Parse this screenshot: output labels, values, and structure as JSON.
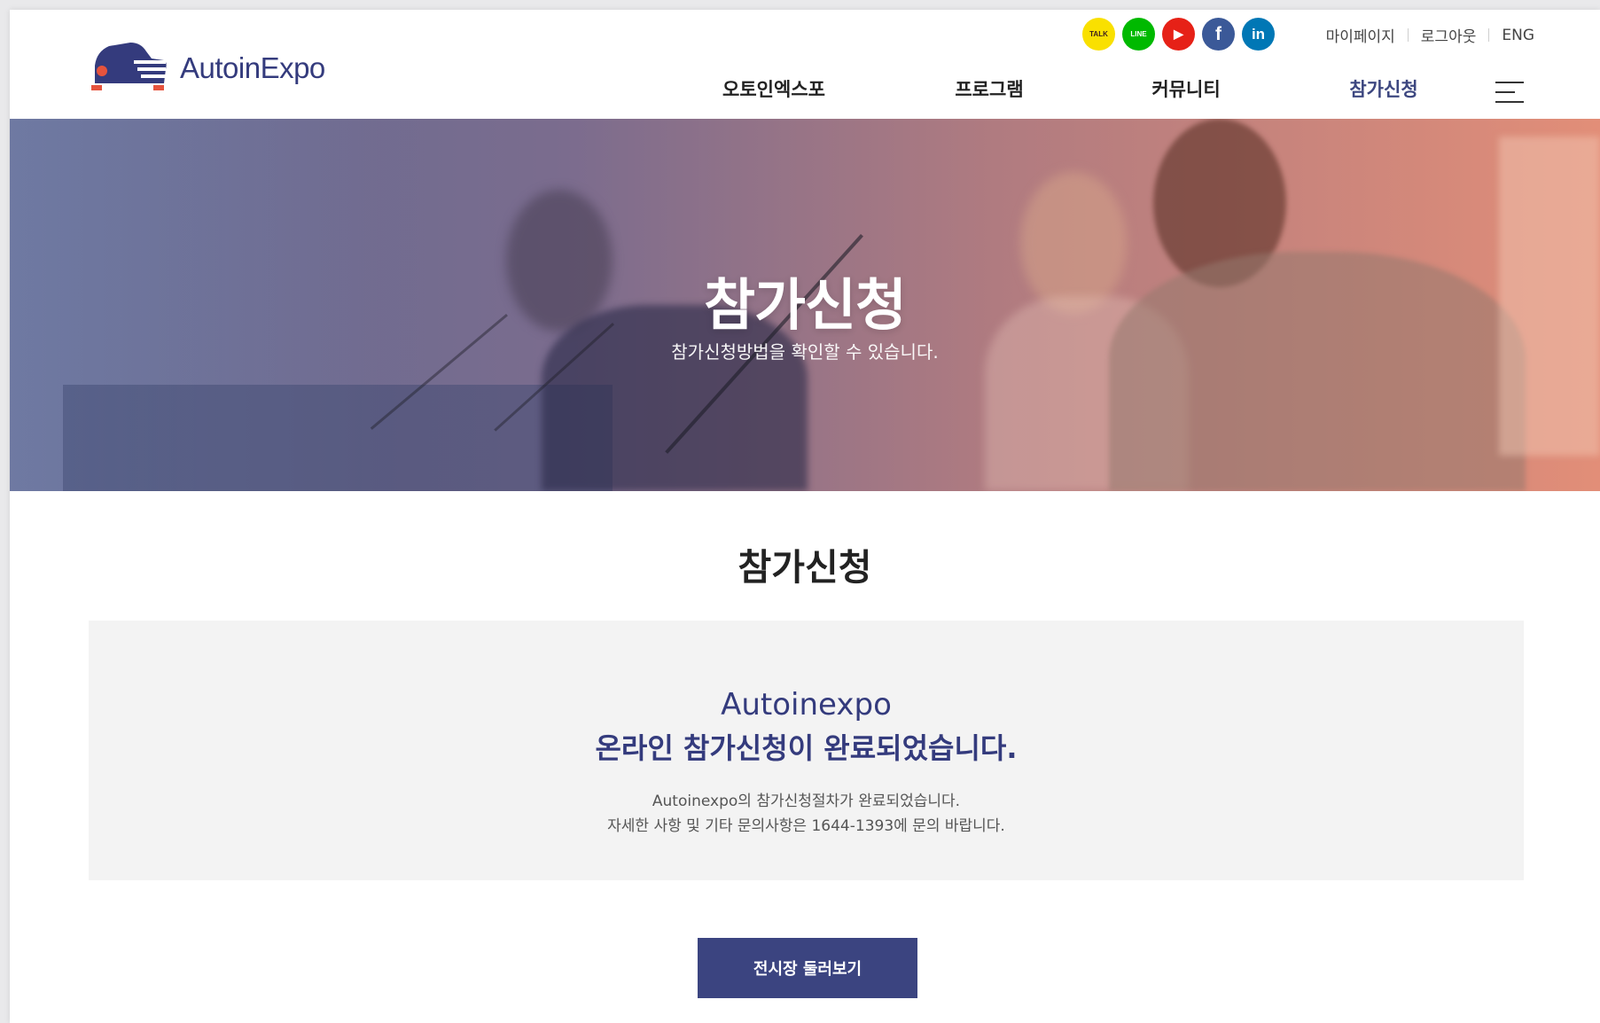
{
  "header": {
    "logo_text": "AutoinExpo",
    "social": [
      {
        "name": "kakaotalk",
        "glyph": "TALK",
        "color": "#f9e000",
        "text_color": "#3b1e1e"
      },
      {
        "name": "line",
        "glyph": "LINE",
        "color": "#00b900",
        "text_color": "#ffffff"
      },
      {
        "name": "youtube",
        "glyph": "▶",
        "color": "#e62117",
        "text_color": "#ffffff"
      },
      {
        "name": "facebook",
        "glyph": "f",
        "color": "#3b5998",
        "text_color": "#ffffff"
      },
      {
        "name": "linkedin",
        "glyph": "in",
        "color": "#0077b5",
        "text_color": "#ffffff"
      }
    ],
    "top_links": {
      "mypage": "마이페이지",
      "logout": "로그아웃",
      "lang": "ENG"
    },
    "nav": [
      {
        "label": "오토인엑스포"
      },
      {
        "label": "프로그램"
      },
      {
        "label": "커뮤니티"
      },
      {
        "label": "참가신청",
        "active": true
      }
    ]
  },
  "hero": {
    "title": "참가신청",
    "subtitle": "참가신청방법을 확인할 수 있습니다."
  },
  "content": {
    "section_title": "참가신청",
    "notice": {
      "brand": "Autoinexpo",
      "message": "온라인 참가신청이 완료되었습니다.",
      "desc_line1": "Autoinexpo의 참가신청절차가 완료되었습니다.",
      "desc_line2": "자세한 사항 및 기타 문의사항은 1644-1393에 문의 바랍니다."
    },
    "button_label": "전시장 둘러보기"
  },
  "colors": {
    "brand_navy": "#343b7d",
    "button": "#3b4480",
    "logo_red": "#e6533d",
    "notice_bg": "#f3f3f3"
  }
}
